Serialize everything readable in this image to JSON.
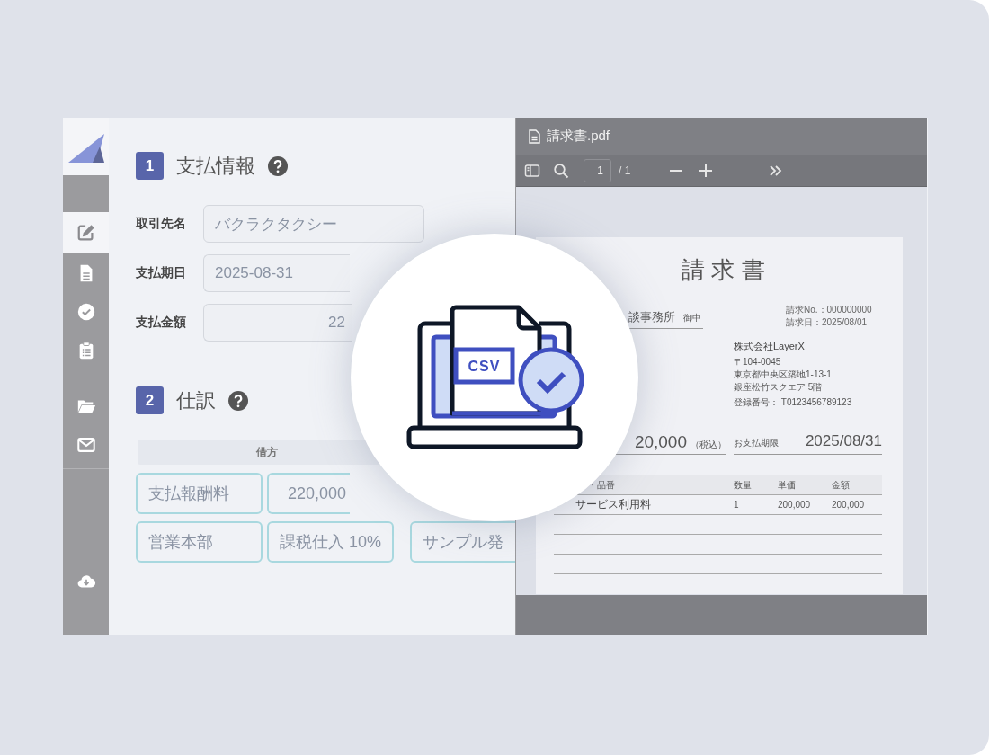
{
  "sidebar": {
    "items": [
      {
        "kind": "edit",
        "selected": true
      },
      {
        "kind": "document",
        "selected": false
      },
      {
        "kind": "check",
        "selected": false
      },
      {
        "kind": "clipboard",
        "selected": false
      }
    ],
    "secondary_items": [
      {
        "kind": "folder",
        "selected": false
      },
      {
        "kind": "mail",
        "selected": false
      }
    ],
    "footer_items": [
      {
        "kind": "download",
        "selected": false
      }
    ]
  },
  "form": {
    "sections": [
      {
        "number": "1",
        "title": "支払情報",
        "fields": [
          {
            "label": "取引先名",
            "value": "バクラクタクシー",
            "kind": "text"
          },
          {
            "label": "支払期日",
            "value": "2025-08-31",
            "kind": "text"
          },
          {
            "label": "支払金額",
            "value": "22",
            "kind": "amount"
          }
        ]
      },
      {
        "number": "2",
        "title": "仕訳",
        "journal": {
          "header": "借方",
          "rows": [
            [
              {
                "kind": "text",
                "value": "支払報酬料"
              },
              {
                "kind": "amount",
                "value": "220,000"
              }
            ],
            [
              {
                "kind": "text",
                "value": "営業本部"
              },
              {
                "kind": "text",
                "value": "課税仕入 10%"
              },
              {
                "kind": "text",
                "value": "サンプル発"
              }
            ]
          ]
        }
      }
    ]
  },
  "pdf_viewer": {
    "filename": "請求書.pdf",
    "page_input": "1",
    "page_total": "/ 1",
    "document": {
      "title": "請 求 書",
      "recipient": "談事務所",
      "honorific": "御中",
      "meta": [
        "請求No.：000000000",
        "請求日：2025/08/01"
      ],
      "issuer": "株式会社LayerX",
      "address": [
        "〒104-0045",
        "東京都中央区築地1-13-1",
        "銀座松竹スクエア 5階"
      ],
      "registration": "登録番号： T0123456789123",
      "total": "20,000",
      "tax_note": "（税込）",
      "due_label": "お支払期限",
      "due_date": "2025/08/31",
      "table": {
        "columns": [
          "・品番",
          "数量",
          "単価",
          "金額"
        ],
        "rows": [
          [
            "サービス利用料",
            "1",
            "200,000",
            "200,000"
          ]
        ]
      }
    }
  },
  "overlay": {
    "file_label": "CSV"
  }
}
